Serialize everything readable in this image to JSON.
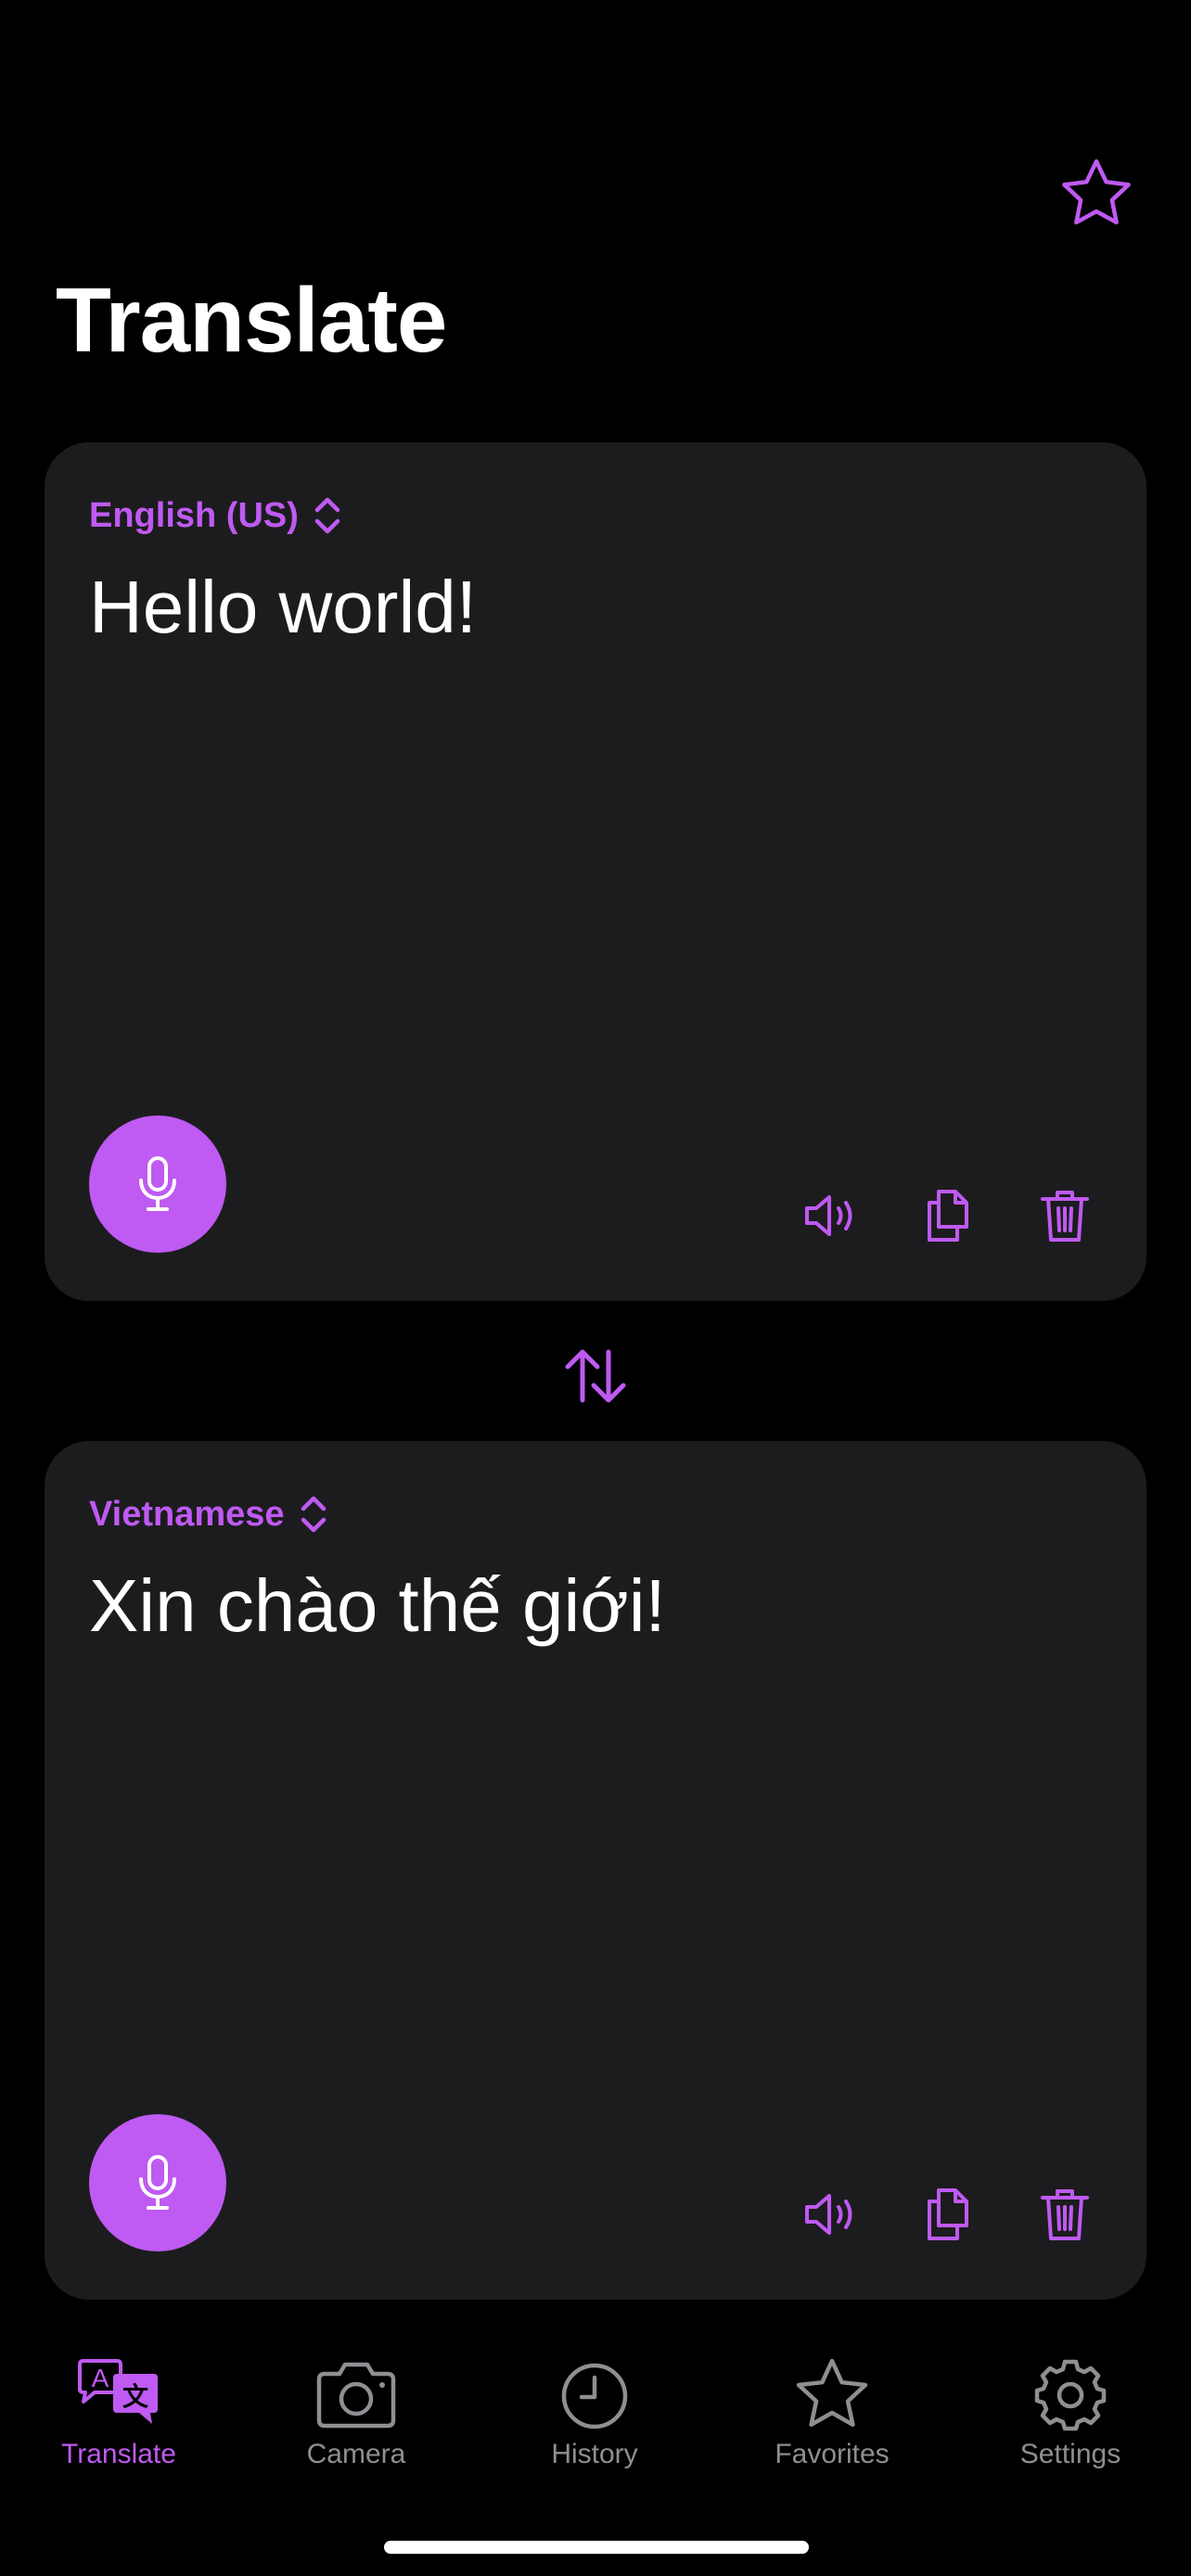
{
  "header": {
    "title": "Translate",
    "favorite_icon": "star-outline-icon"
  },
  "source": {
    "language": "English (US)",
    "text": "Hello world!",
    "icons": {
      "selector": "chevron-up-down-icon",
      "mic": "microphone-icon",
      "speak": "speaker-icon",
      "copy": "copy-icon",
      "delete": "trash-icon"
    }
  },
  "swap": {
    "icon": "swap-arrows-icon"
  },
  "target": {
    "language": "Vietnamese",
    "text": "Xin chào thế giới!",
    "icons": {
      "selector": "chevron-up-down-icon",
      "mic": "microphone-icon",
      "speak": "speaker-icon",
      "copy": "copy-icon",
      "delete": "trash-icon"
    }
  },
  "tabbar": {
    "active": "Translate",
    "tabs": [
      {
        "label": "Translate",
        "icon": "translate-bubbles-icon"
      },
      {
        "label": "Camera",
        "icon": "camera-icon"
      },
      {
        "label": "History",
        "icon": "clock-icon"
      },
      {
        "label": "Favorites",
        "icon": "star-icon"
      },
      {
        "label": "Settings",
        "icon": "gear-icon"
      }
    ]
  },
  "colors": {
    "accent": "#bf5af2",
    "panel": "#1c1c1e",
    "background": "#000000",
    "inactive": "#8e8e93",
    "text": "#ffffff"
  }
}
